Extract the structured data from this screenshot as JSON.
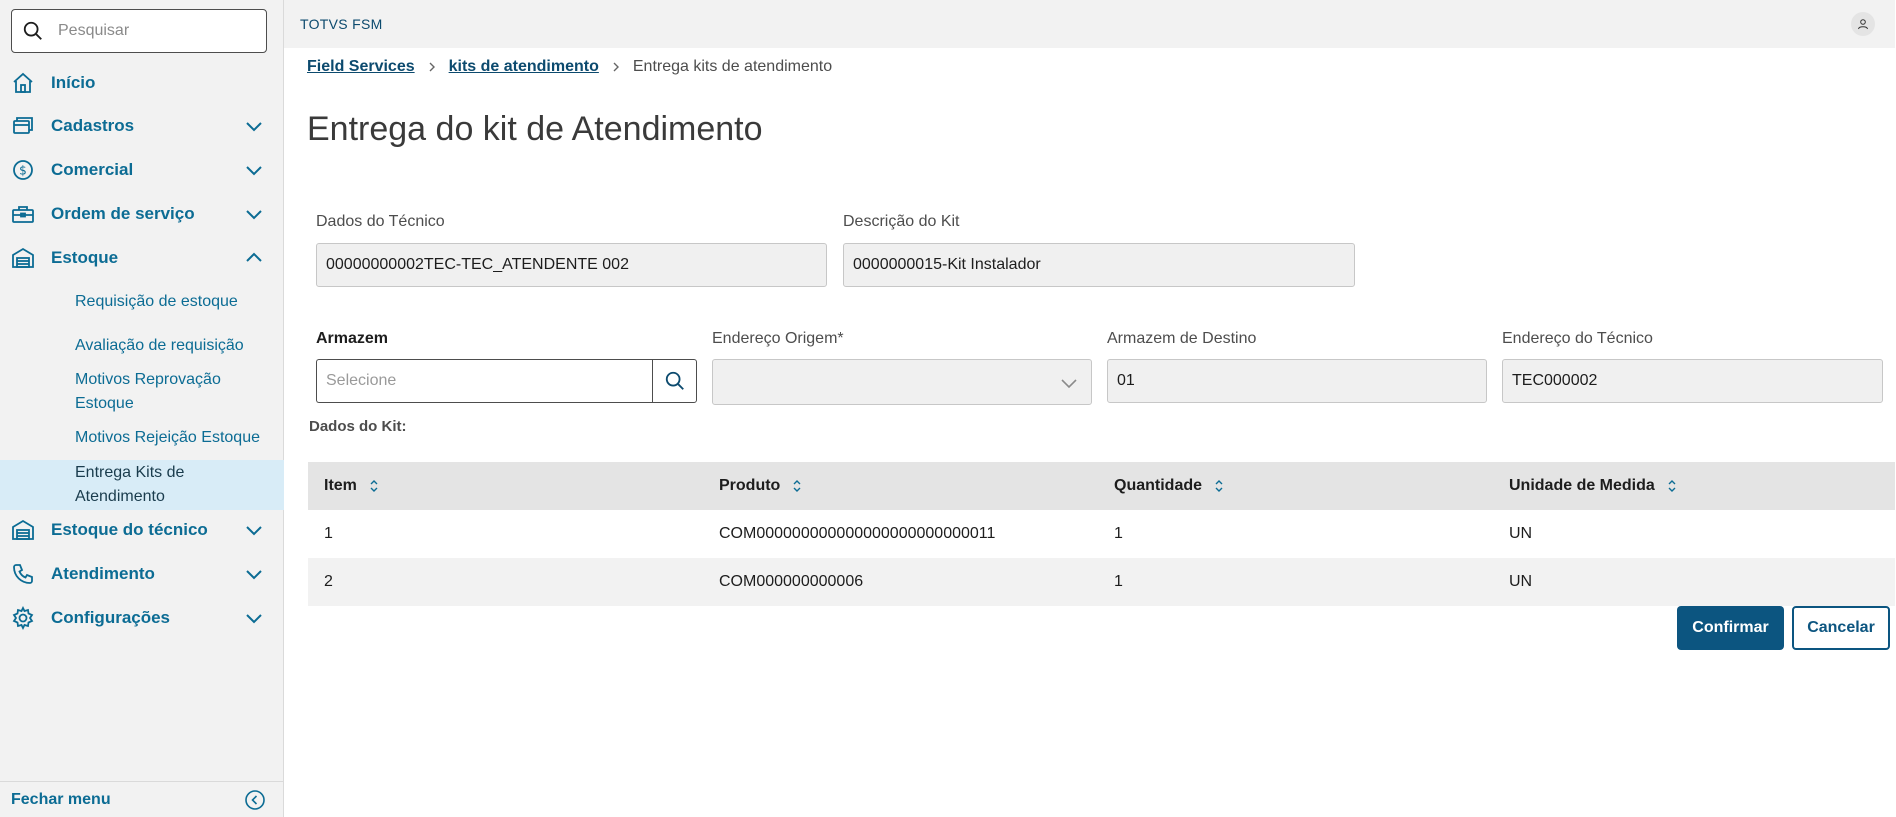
{
  "search": {
    "placeholder": "Pesquisar"
  },
  "sidebar": {
    "items": [
      {
        "label": "Início",
        "icon": "home-icon"
      },
      {
        "label": "Cadastros",
        "icon": "cards-icon"
      },
      {
        "label": "Comercial",
        "icon": "dollar-icon"
      },
      {
        "label": "Ordem de serviço",
        "icon": "toolbox-icon"
      },
      {
        "label": "Estoque",
        "icon": "warehouse-icon",
        "expanded": true
      },
      {
        "label": "Estoque do técnico",
        "icon": "warehouse-icon"
      },
      {
        "label": "Atendimento",
        "icon": "phone-icon"
      },
      {
        "label": "Configurações",
        "icon": "gear-icon"
      }
    ],
    "subitems": [
      {
        "label": "Requisição de estoque"
      },
      {
        "label": "Avaliação de requisição"
      },
      {
        "label": "Motivos Reprovação Estoque"
      },
      {
        "label": "Motivos Rejeição Estoque"
      },
      {
        "label": "Entrega Kits de Atendimento",
        "active": true
      }
    ],
    "footer_label": "Fechar menu"
  },
  "topbar": {
    "app_title": "TOTVS FSM"
  },
  "breadcrumb": {
    "items": [
      "Field Services",
      "kits de atendimento",
      "Entrega kits de atendimento"
    ]
  },
  "page": {
    "title": "Entrega do kit de Atendimento"
  },
  "form": {
    "tecnico": {
      "label": "Dados do Técnico",
      "value": "00000000002TEC-TEC_ATENDENTE 002"
    },
    "kit": {
      "label": "Descrição do Kit",
      "value": "0000000015-Kit Instalador"
    },
    "armazem": {
      "label": "Armazem",
      "placeholder": "Selecione"
    },
    "endereco_origem": {
      "label": "Endereço Origem*",
      "value": ""
    },
    "armazem_destino": {
      "label": "Armazem de Destino",
      "value": "01"
    },
    "endereco_tecnico": {
      "label": "Endereço do Técnico",
      "value": "TEC000002"
    }
  },
  "kit_section": {
    "label": "Dados do Kit:"
  },
  "table": {
    "headers": [
      "Item",
      "Produto",
      "Quantidade",
      "Unidade de Medida"
    ],
    "rows": [
      [
        "1",
        "COM000000000000000000000000011",
        "1",
        "UN"
      ],
      [
        "2",
        "COM000000000006",
        "1",
        "UN"
      ]
    ]
  },
  "actions": {
    "confirm": "Confirmar",
    "cancel": "Cancelar"
  },
  "colors": {
    "accent": "#0c6c94",
    "primary_button": "#0c5580",
    "active_item_bg": "#d8ecf7"
  }
}
